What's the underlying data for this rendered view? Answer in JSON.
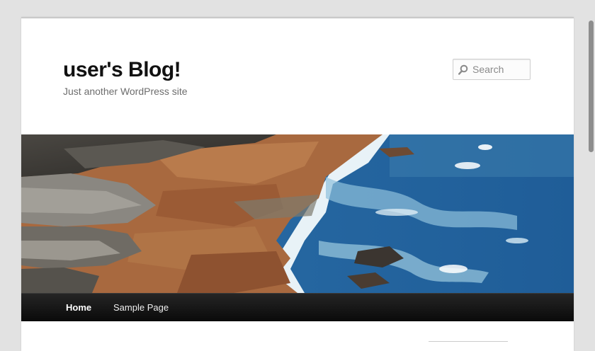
{
  "site": {
    "title": "user's Blog!",
    "description": "Just another WordPress site"
  },
  "search": {
    "placeholder": "Search",
    "value": ""
  },
  "header_image": {
    "subject": "rocky coastline with ocean waves"
  },
  "nav": {
    "items": [
      {
        "label": "Home",
        "current": true
      },
      {
        "label": "Sample Page",
        "current": false
      }
    ]
  },
  "colors": {
    "background": "#e2e2e2",
    "page": "#ffffff",
    "title": "#111111",
    "description": "#6d6d6d",
    "nav_bar": "#111111",
    "nav_text": "#eeeeee"
  },
  "icons": {
    "search": "search-icon"
  }
}
